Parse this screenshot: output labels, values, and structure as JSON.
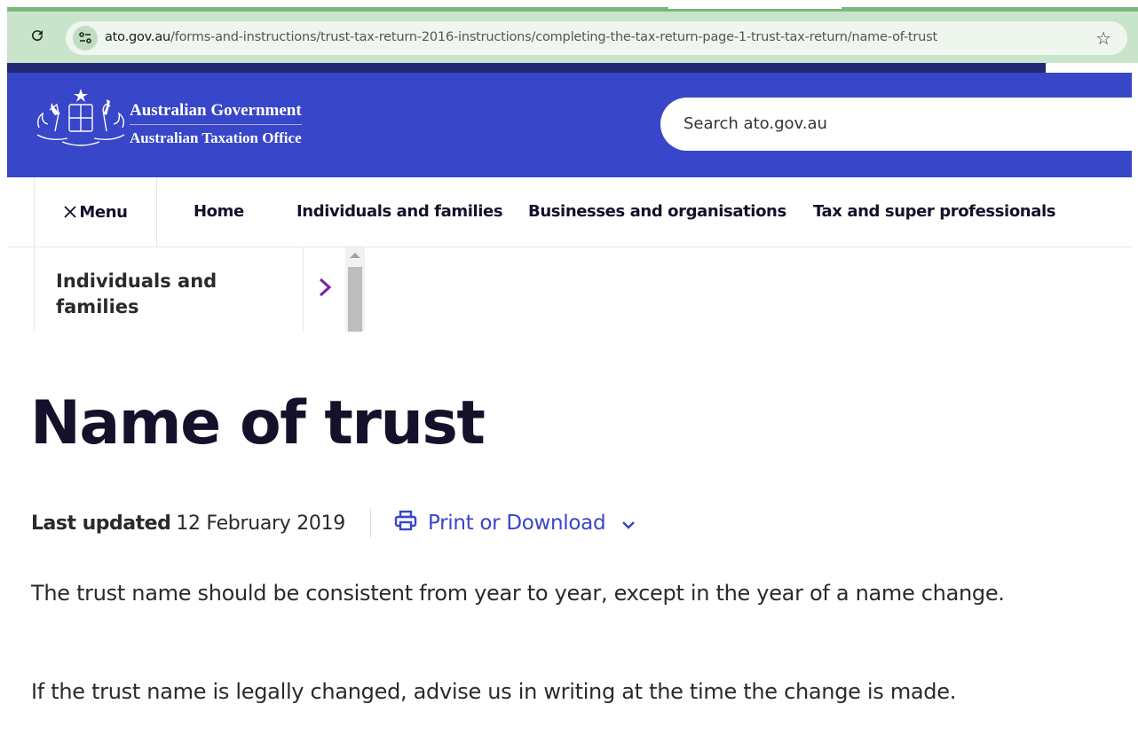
{
  "browser": {
    "url_host": "ato.gov.au",
    "url_path": "/forms-and-instructions/trust-tax-return-2016-instructions/completing-the-tax-return-page-1-trust-tax-return/name-of-trust",
    "icons": {
      "reload": "reload-icon",
      "site_info": "tune-icon",
      "bookmark": "star-icon"
    }
  },
  "header": {
    "brand_line1": "Australian Government",
    "brand_line2": "Australian Taxation Office",
    "search_placeholder": "Search ato.gov.au",
    "colors": {
      "header_bg": "#3846c9",
      "top_stripe": "#232a73"
    }
  },
  "nav": {
    "menu_label": "Menu",
    "items": [
      {
        "label": "Home"
      },
      {
        "label": "Individuals and families"
      },
      {
        "label": "Businesses and organisations"
      },
      {
        "label": "Tax and super professionals"
      }
    ]
  },
  "menu_dropdown": {
    "items": [
      {
        "label": "Individuals and families"
      }
    ],
    "arrow_color": "#7a1fa2"
  },
  "page": {
    "title": "Name of trust",
    "last_updated_label": "Last updated",
    "last_updated_date": "12 February 2019",
    "print_label": "Print or Download",
    "link_color": "#3846c9",
    "paragraphs": [
      "The trust name should be consistent from year to year, except in the year of a name change.",
      "If the trust name is legally changed, advise us in writing at the time the change is made."
    ]
  }
}
